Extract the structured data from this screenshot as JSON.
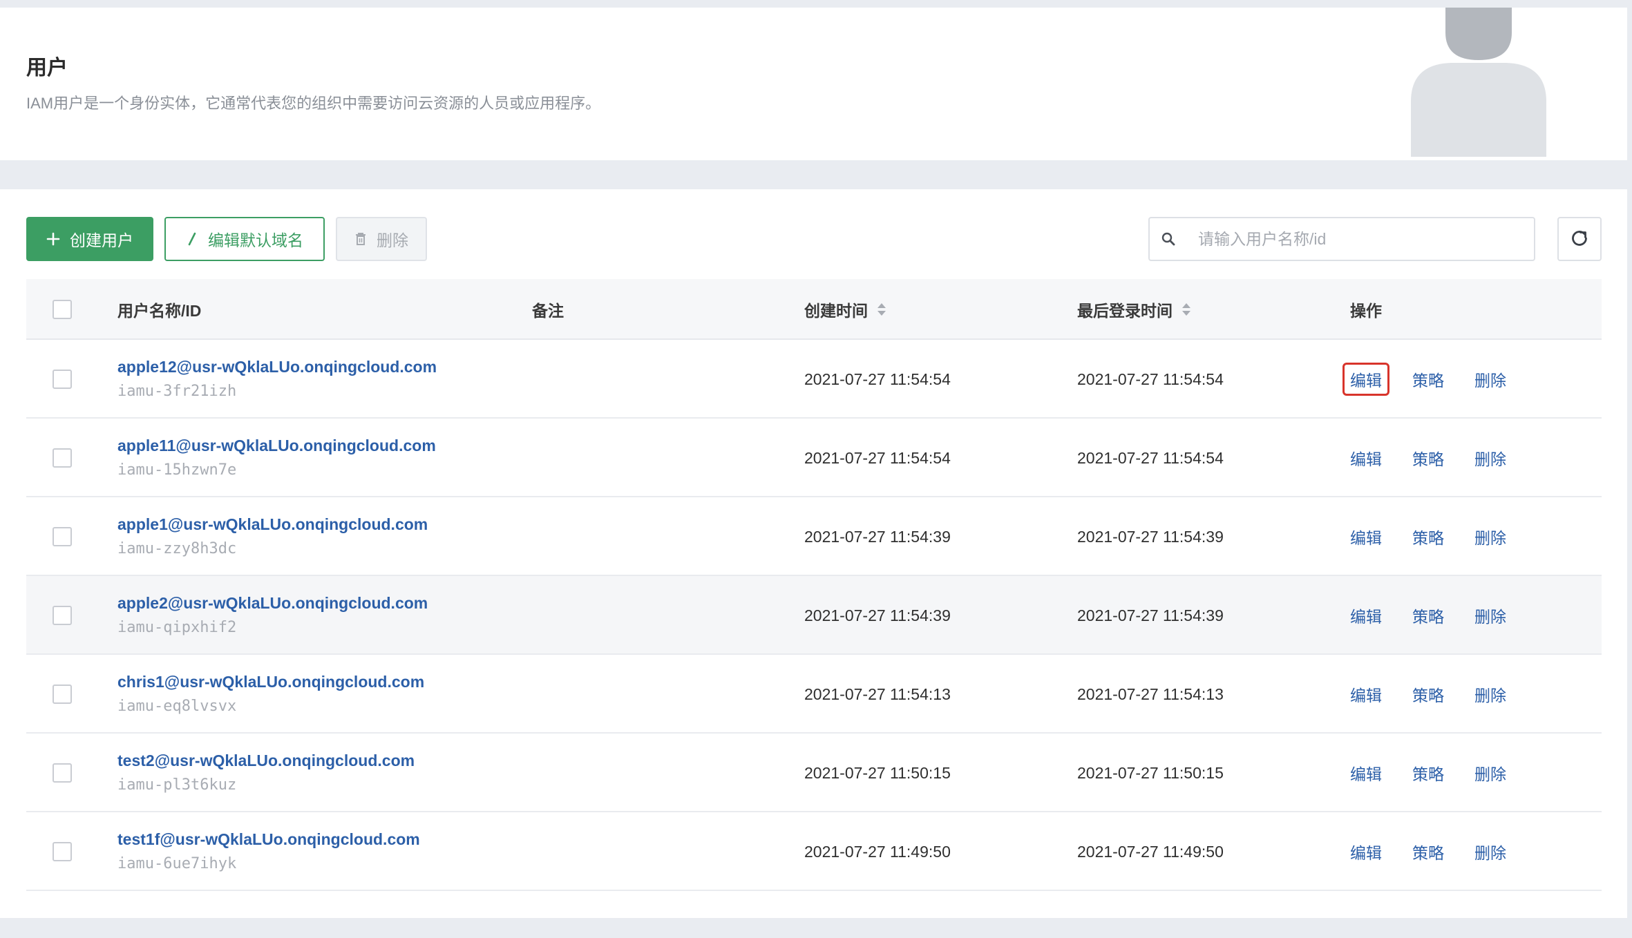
{
  "header": {
    "title": "用户",
    "description": "IAM用户是一个身份实体，它通常代表您的组织中需要访问云资源的人员或应用程序。"
  },
  "toolbar": {
    "create_label": "创建用户",
    "edit_domain_label": "编辑默认域名",
    "delete_label": "删除",
    "search_placeholder": "请输入用户名称/id"
  },
  "table": {
    "columns": {
      "name": "用户名称/ID",
      "note": "备注",
      "created": "创建时间",
      "last_login": "最后登录时间",
      "actions": "操作"
    },
    "action_labels": {
      "edit": "编辑",
      "policy": "策略",
      "delete": "删除"
    },
    "rows": [
      {
        "name": "apple12@usr-wQklaLUo.onqingcloud.com",
        "id": "iamu-3fr21izh",
        "note": "",
        "created": "2021-07-27 11:54:54",
        "last_login": "2021-07-27 11:54:54"
      },
      {
        "name": "apple11@usr-wQklaLUo.onqingcloud.com",
        "id": "iamu-15hzwn7e",
        "note": "",
        "created": "2021-07-27 11:54:54",
        "last_login": "2021-07-27 11:54:54"
      },
      {
        "name": "apple1@usr-wQklaLUo.onqingcloud.com",
        "id": "iamu-zzy8h3dc",
        "note": "",
        "created": "2021-07-27 11:54:39",
        "last_login": "2021-07-27 11:54:39"
      },
      {
        "name": "apple2@usr-wQklaLUo.onqingcloud.com",
        "id": "iamu-qipxhif2",
        "note": "",
        "created": "2021-07-27 11:54:39",
        "last_login": "2021-07-27 11:54:39"
      },
      {
        "name": "chris1@usr-wQklaLUo.onqingcloud.com",
        "id": "iamu-eq8lvsvx",
        "note": "",
        "created": "2021-07-27 11:54:13",
        "last_login": "2021-07-27 11:54:13"
      },
      {
        "name": "test2@usr-wQklaLUo.onqingcloud.com",
        "id": "iamu-pl3t6kuz",
        "note": "",
        "created": "2021-07-27 11:50:15",
        "last_login": "2021-07-27 11:50:15"
      },
      {
        "name": "test1f@usr-wQklaLUo.onqingcloud.com",
        "id": "iamu-6ue7ihyk",
        "note": "",
        "created": "2021-07-27 11:49:50",
        "last_login": "2021-07-27 11:49:50"
      }
    ]
  },
  "colors": {
    "primary_green": "#3c9e63",
    "link_blue": "#2c5fa8",
    "highlight_red": "#d8342b"
  },
  "icons": {
    "create": "plus-icon",
    "edit_domain": "pencil-icon",
    "delete": "trash-icon",
    "search": "search-icon",
    "refresh": "refresh-icon",
    "sort": "sort-icon",
    "header_art": "user-avatar-illustration"
  }
}
